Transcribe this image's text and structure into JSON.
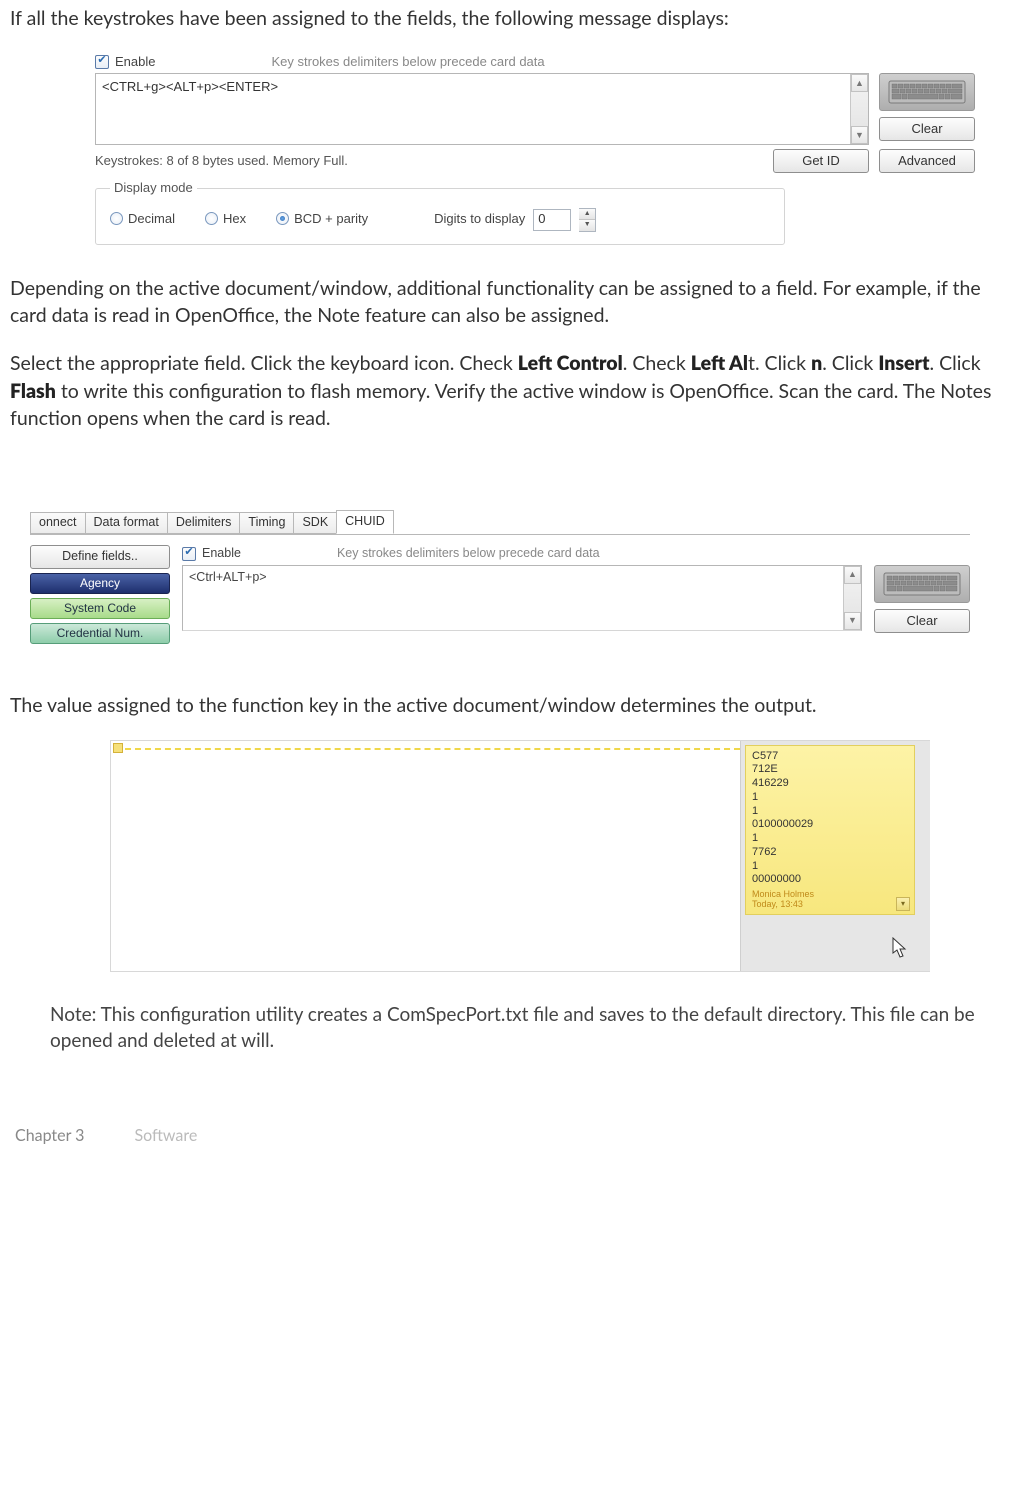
{
  "intro_paragraph": "If all the keystrokes have been assigned to the fields, the following message displays:",
  "panel1": {
    "enable_label": "Enable",
    "hint": "Key strokes delimiters below precede card data",
    "keystrokes_value": "<CTRL+g><ALT+p><ENTER>",
    "clear_label": "Clear",
    "status_text": "Keystrokes: 8 of 8 bytes used. Memory Full.",
    "getid_label": "Get ID",
    "advanced_label": "Advanced",
    "display_mode_legend": "Display mode",
    "radio_decimal": "Decimal",
    "radio_hex": "Hex",
    "radio_bcd": "BCD + parity",
    "digits_label": "Digits to display",
    "digits_value": "0"
  },
  "mid_para": "Depending on the active document/window, additional functionality can be assigned to a field. For example, if the card data is read in OpenOffice, the Note feature can also be assigned.",
  "instruct": {
    "pre1": "Select the appropriate field. Click the keyboard icon. Check ",
    "b1": "Left Control",
    "mid1": ". Check ",
    "b2": "Left Al",
    "mid1b": "t. Click ",
    "b3": "n",
    "mid2": ". Click ",
    "b4": "Insert",
    "mid3": ". Click ",
    "b5": "Flash",
    "post": " to write this configuration to flash memory. Verify the active window is OpenOffice. Scan the card. The Notes function opens when the card is read."
  },
  "panel2": {
    "tabs": [
      "onnect",
      "Data format",
      "Delimiters",
      "Timing",
      "SDK",
      "CHUID"
    ],
    "active_tab_index": 5,
    "define_label": "Define fields..",
    "enable_label": "Enable",
    "hint": "Key strokes delimiters below precede card data",
    "keystrokes_value": "<Ctrl+ALT+p>",
    "clear_label": "Clear",
    "fields": {
      "agency": "Agency",
      "system": "System Code",
      "credential": "Credential Num."
    }
  },
  "after_p2": "The value assigned to the function key in the active document/window determines the output.",
  "panel3": {
    "note_lines": [
      "C577",
      "712E",
      "416229",
      "1",
      "1",
      "0100000029",
      "1",
      "7762",
      "1",
      "00000000"
    ],
    "author": "Monica Holmes",
    "timestamp": "Today, 13:43"
  },
  "note_block": "Note: This configuration utility creates a ComSpecPort.txt file and saves to the default directory. This file can be opened and deleted at will.",
  "footer": {
    "chapter": "Chapter 3",
    "title": "Software"
  }
}
